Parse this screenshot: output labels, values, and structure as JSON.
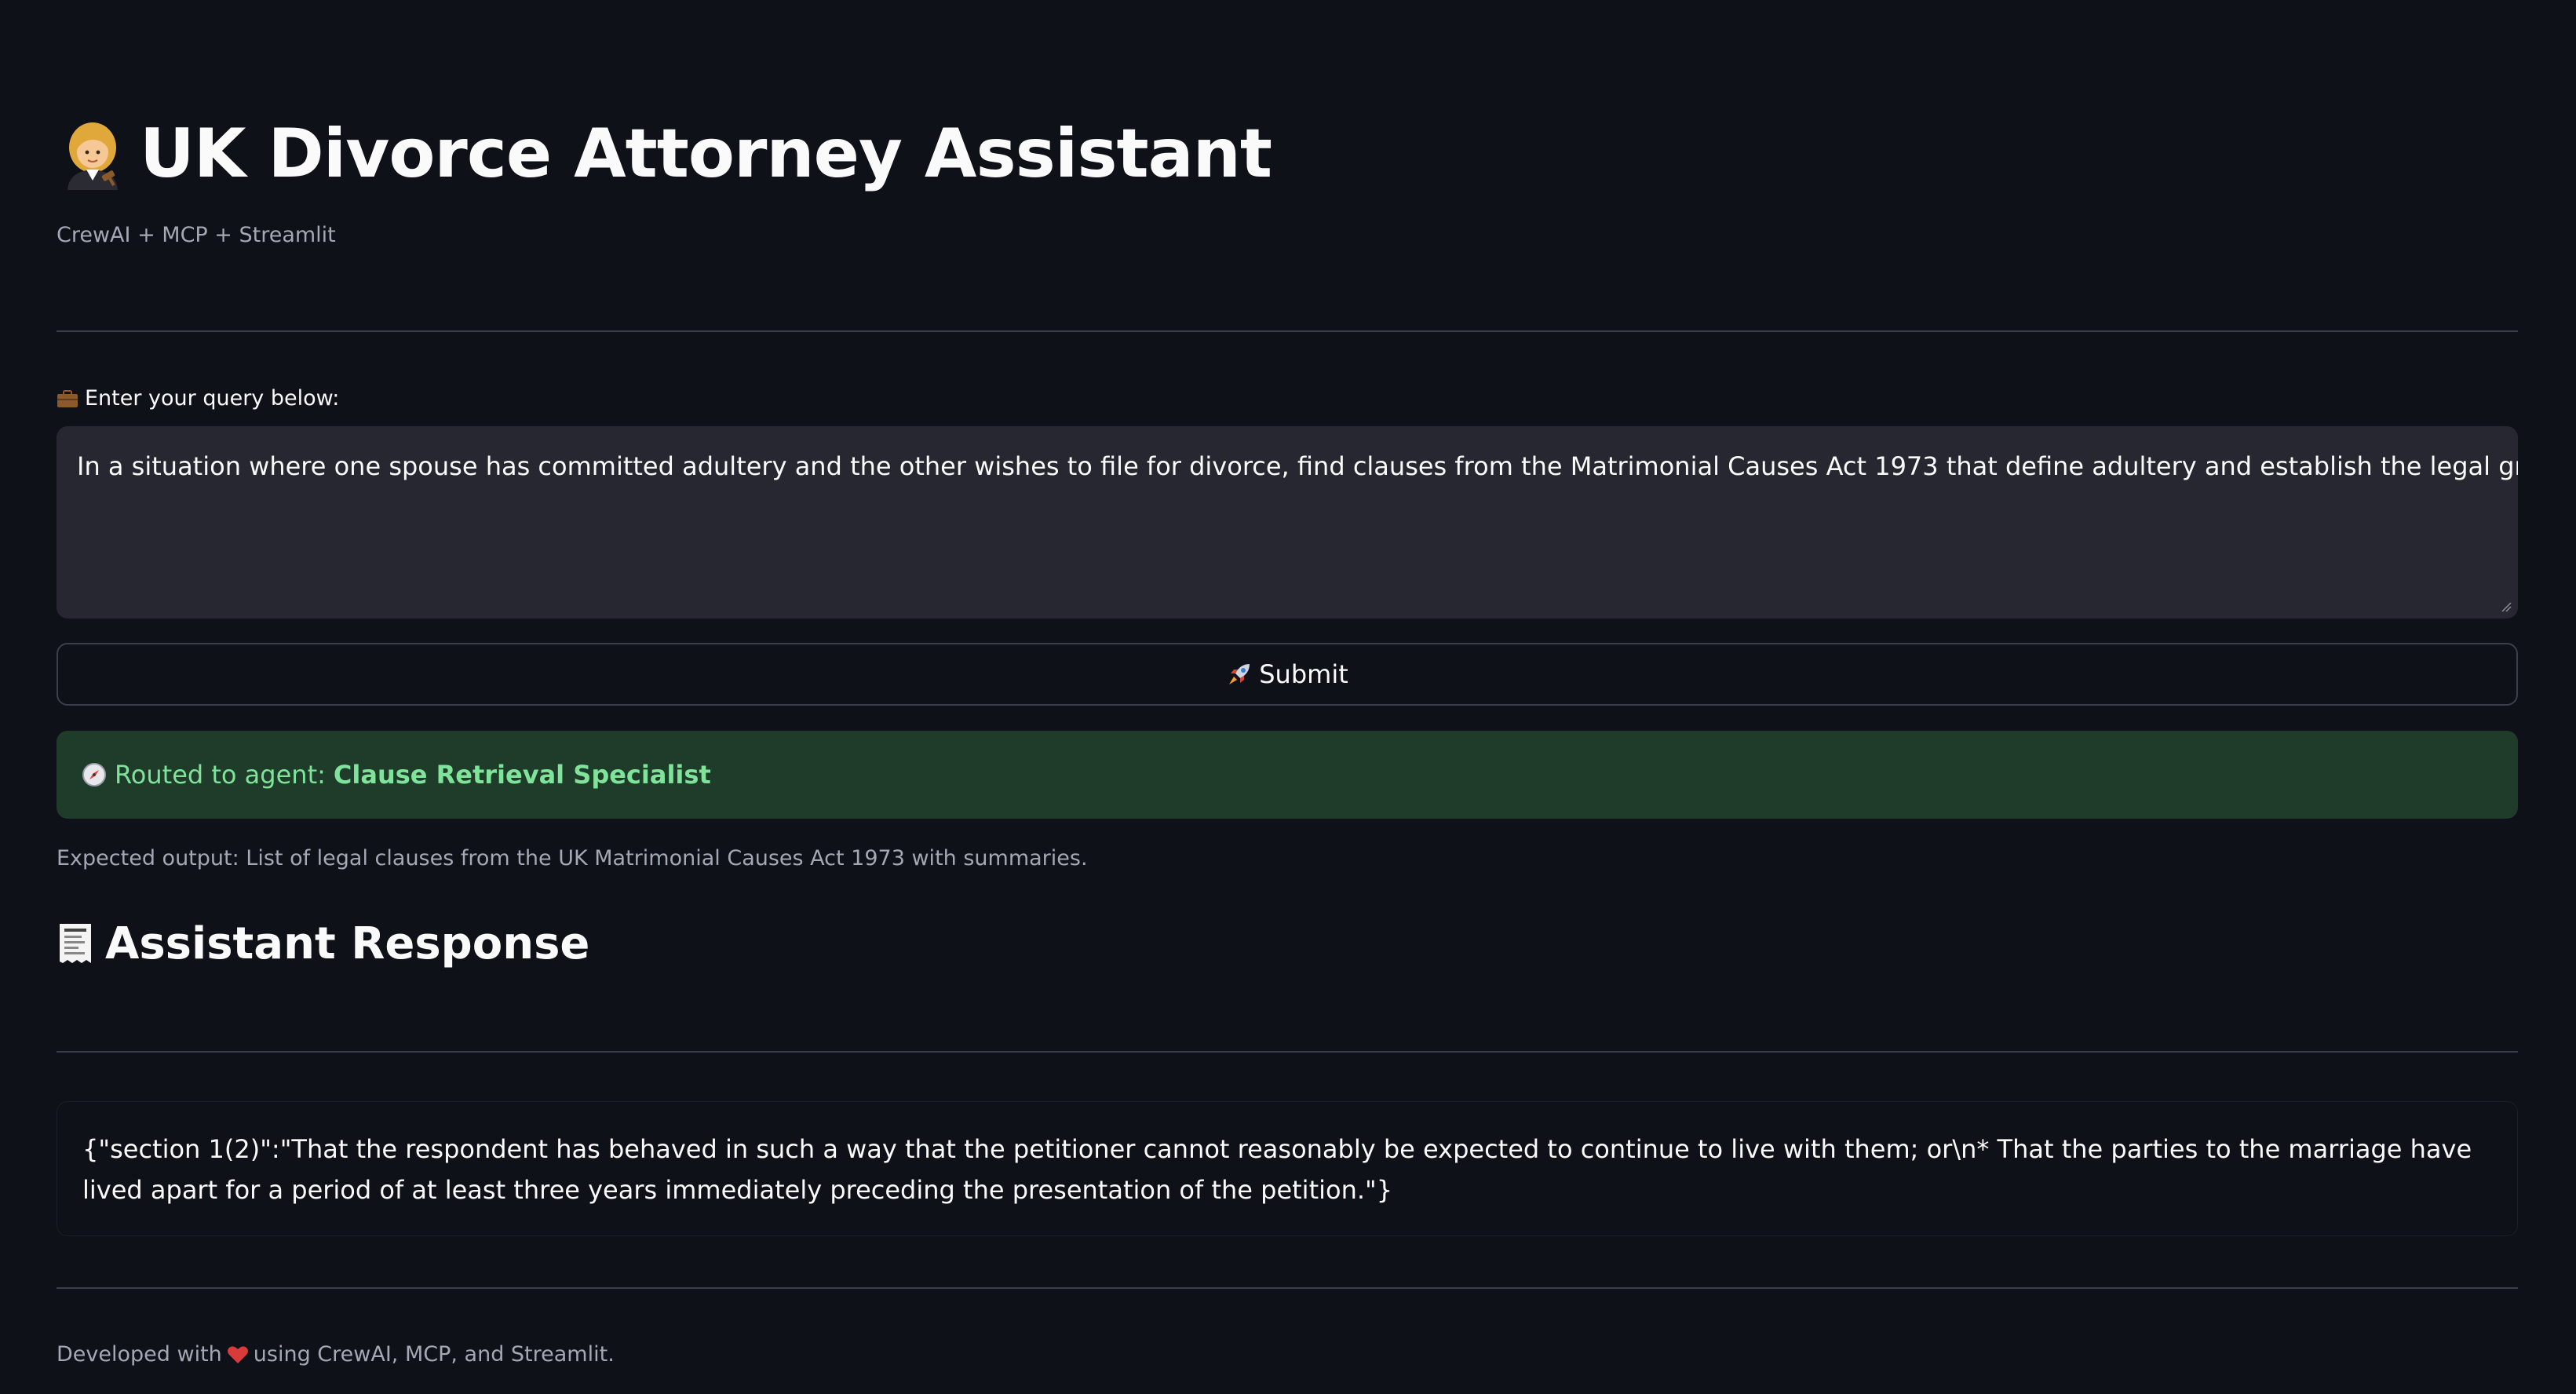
{
  "header": {
    "title_icon": "woman-judge-icon",
    "title": "UK Divorce Attorney Assistant",
    "caption": "CrewAI + MCP + Streamlit"
  },
  "query": {
    "label_icon": "briefcase-icon",
    "label": "Enter your query below:",
    "value": "In a situation where one spouse has committed adultery and the other wishes to file for divorce, find clauses from the Matrimonial Causes Act 1973 that define adultery and establish the legal grounds for such a divorce."
  },
  "submit": {
    "icon": "rocket-icon",
    "label": "Submit"
  },
  "routing": {
    "icon": "compass-icon",
    "prefix": "Routed to agent:",
    "agent": "Clause Retrieval Specialist"
  },
  "expected_output": "Expected output: List of legal clauses from the UK Matrimonial Causes Act 1973 with summaries.",
  "response": {
    "icon": "receipt-icon",
    "heading": "Assistant Response",
    "text": "{\"section 1(2)\":\"That the respondent has behaved in such a way that the petitioner cannot reasonably be expected to continue to live with them; or\\n* That the parties to the marriage have lived apart for a period of at least three years immediately preceding the presentation of the petition.\"}"
  },
  "footer": {
    "prefix": "Developed with",
    "icon": "heart-icon",
    "suffix": "using CrewAI, MCP, and Streamlit."
  },
  "colors": {
    "background": "#0e1117",
    "input_background": "#262730",
    "success_background": "#1f3b2a",
    "success_text": "#7fe39a",
    "muted_text": "#a3a8b4",
    "heart": "#d93a3a"
  }
}
